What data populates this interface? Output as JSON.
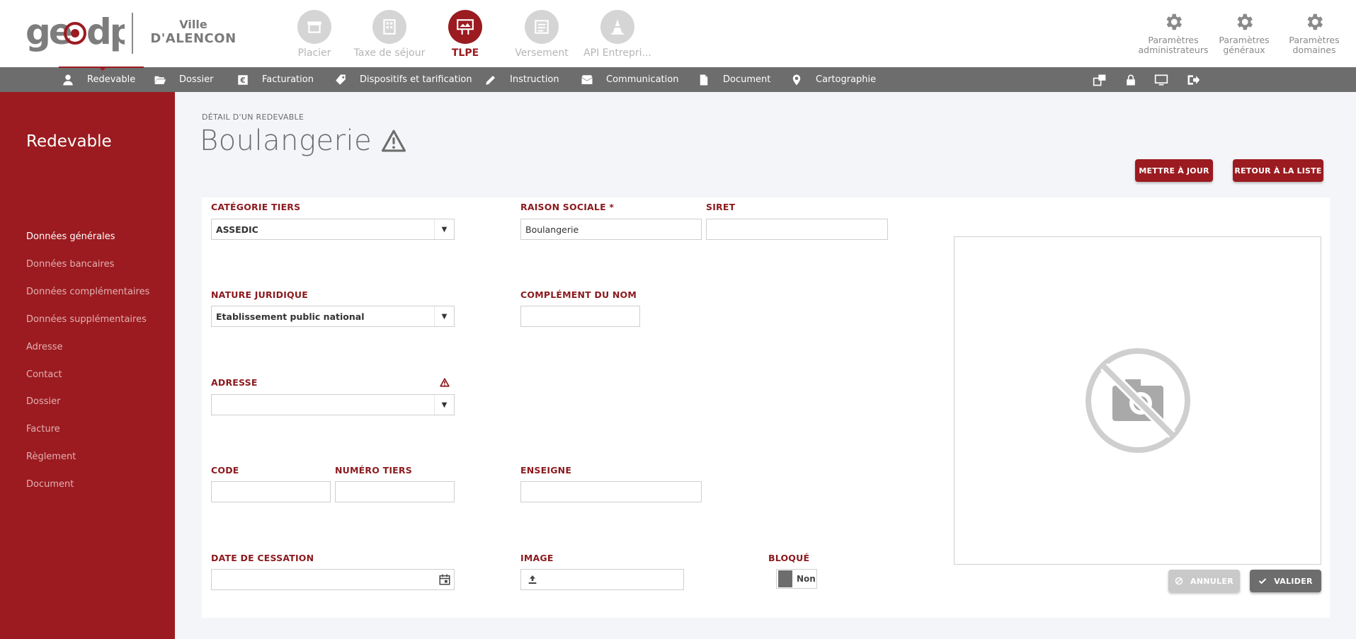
{
  "header": {
    "logo_text": "geodp",
    "city_line1": "Ville",
    "city_line2": "D'ALENCON",
    "apps": [
      {
        "label": "Placier",
        "icon": "market-stall-icon",
        "active": false
      },
      {
        "label": "Taxe de séjour",
        "icon": "building-icon",
        "active": false
      },
      {
        "label": "TLPE",
        "icon": "billboard-icon",
        "active": true
      },
      {
        "label": "Versement",
        "icon": "register-icon",
        "active": false
      },
      {
        "label": "API Entrepri...",
        "icon": "cone-icon",
        "active": false
      }
    ],
    "params": [
      {
        "line1": "Paramètres",
        "line2": "administrateurs",
        "icon": "gear-icon"
      },
      {
        "line1": "Paramètres",
        "line2": "généraux",
        "icon": "gear-icon"
      },
      {
        "line1": "Paramètres",
        "line2": "domaines",
        "icon": "gear-icon"
      }
    ]
  },
  "nav": {
    "items": [
      {
        "label": "Redevable",
        "icon": "user-icon",
        "active": true
      },
      {
        "label": "Dossier",
        "icon": "folder-icon"
      },
      {
        "label": "Facturation",
        "icon": "euro-icon"
      },
      {
        "label": "Dispositifs et tarification",
        "icon": "tag-icon"
      },
      {
        "label": "Instruction",
        "icon": "pencil-icon"
      },
      {
        "label": "Communication",
        "icon": "envelope-icon"
      },
      {
        "label": "Document",
        "icon": "document-icon"
      },
      {
        "label": "Cartographie",
        "icon": "map-pin-icon"
      }
    ],
    "right_icons": [
      "windows-icon",
      "lock-icon",
      "monitor-icon",
      "logout-icon"
    ]
  },
  "sidebar": {
    "title": "Redevable",
    "items": [
      {
        "label": "Données générales",
        "active": true
      },
      {
        "label": "Données bancaires"
      },
      {
        "label": "Données complémentaires"
      },
      {
        "label": "Données supplémentaires"
      },
      {
        "label": "Adresse"
      },
      {
        "label": "Contact"
      },
      {
        "label": "Dossier"
      },
      {
        "label": "Facture"
      },
      {
        "label": "Règlement"
      },
      {
        "label": "Document"
      }
    ]
  },
  "main": {
    "detail_label": "DÉTAIL D'UN REDEVABLE",
    "title": "Boulangerie",
    "buttons": {
      "update": "METTRE À JOUR",
      "back": "RETOUR À LA LISTE",
      "cancel": "ANNULER",
      "validate": "VALIDER"
    },
    "form": {
      "categorie_tiers": {
        "label": "CATÉGORIE TIERS",
        "value": "ASSEDIC"
      },
      "raison_sociale": {
        "label": "RAISON SOCIALE *",
        "value": "Boulangerie"
      },
      "siret": {
        "label": "SIRET",
        "value": ""
      },
      "nature_juridique": {
        "label": "NATURE JURIDIQUE",
        "value": "Etablissement public national"
      },
      "complement_nom": {
        "label": "COMPLÉMENT DU NOM",
        "value": ""
      },
      "adresse": {
        "label": "ADRESSE",
        "value": ""
      },
      "code": {
        "label": "CODE",
        "value": ""
      },
      "numero_tiers": {
        "label": "NUMÉRO TIERS",
        "value": ""
      },
      "enseigne": {
        "label": "ENSEIGNE",
        "value": ""
      },
      "date_cessation": {
        "label": "DATE DE CESSATION",
        "value": ""
      },
      "image": {
        "label": "IMAGE",
        "value": ""
      },
      "bloque": {
        "label": "BLOQUÉ",
        "value": "Non"
      }
    }
  },
  "colors": {
    "brand": "#9b1b20",
    "nav_bg": "#6d6d6d",
    "label": "#8b1a1e"
  }
}
